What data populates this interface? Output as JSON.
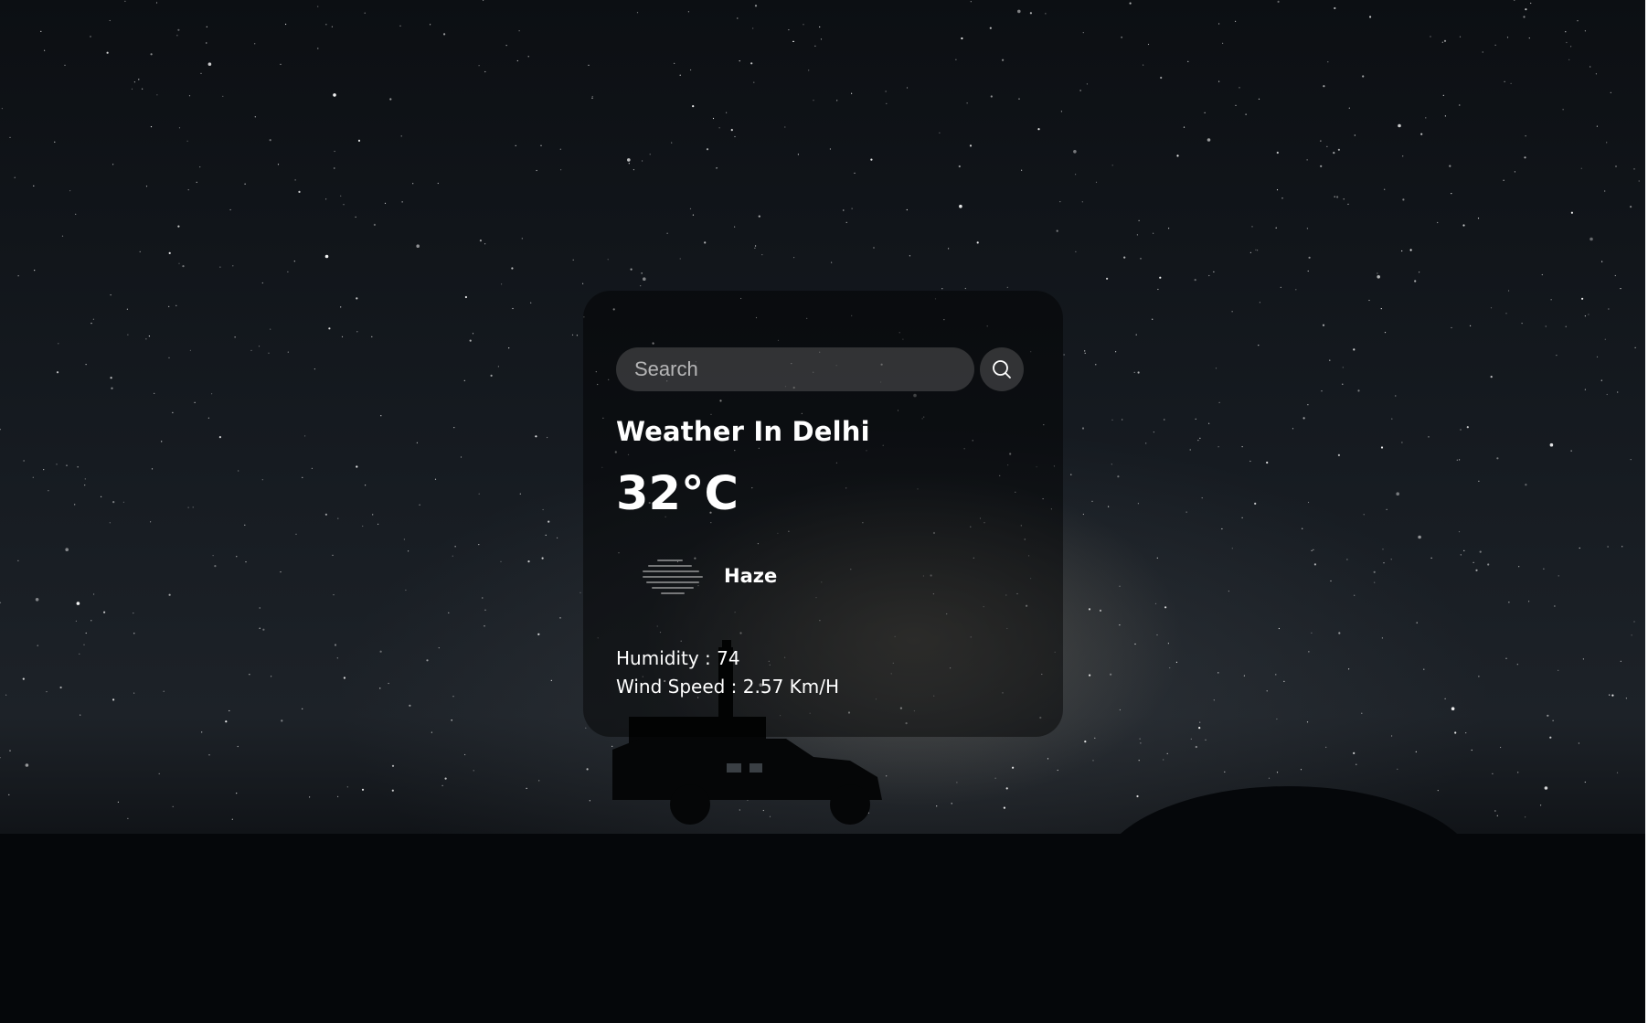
{
  "search": {
    "placeholder": "Search",
    "value": "",
    "button_icon": "search-icon"
  },
  "weather": {
    "title": "Weather In Delhi",
    "temperature": "32°C",
    "condition": "Haze",
    "condition_icon": "haze-icon",
    "humidity": "Humidity : 74",
    "wind_speed": "Wind Speed : 2.57 Km/H"
  },
  "background": {
    "description_icon": "starry-sky-background"
  }
}
